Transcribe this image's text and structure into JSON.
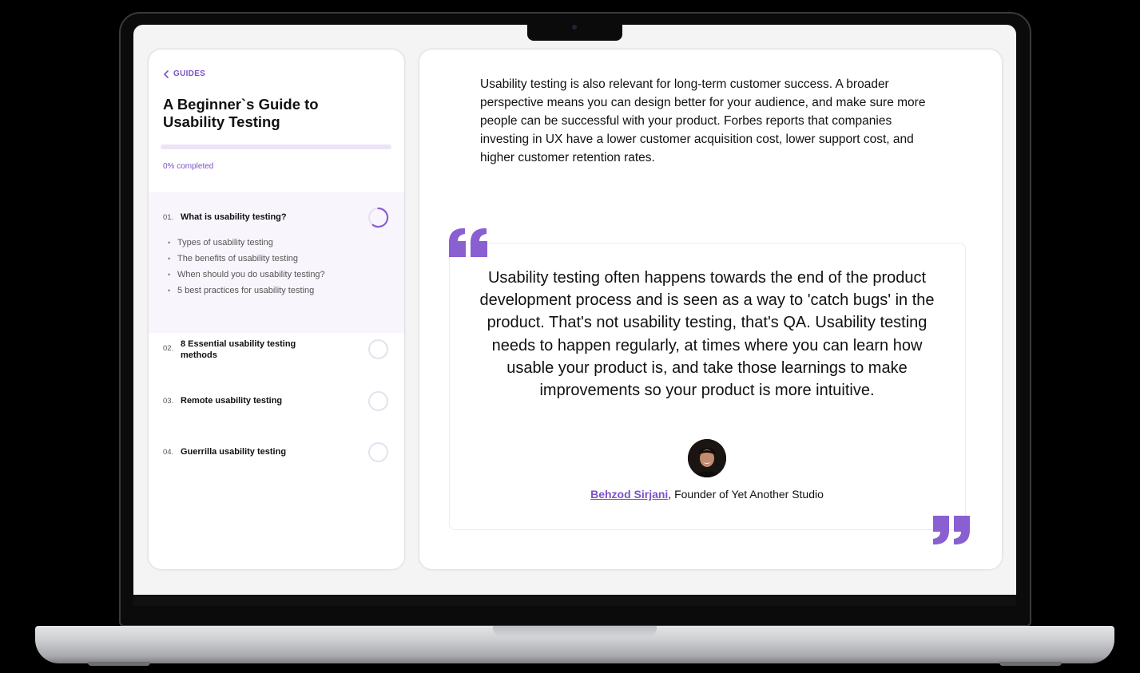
{
  "sidebar": {
    "back_label": "GUIDES",
    "title": "A Beginner`s Guide to Usability Testing",
    "progress_percent": 0,
    "progress_text": "0% completed",
    "chapters": [
      {
        "num": "01.",
        "label": "What is usability testing?",
        "status": "in-progress"
      },
      {
        "num": "02.",
        "label": "8 Essential usability testing methods",
        "status": "not-started"
      },
      {
        "num": "03.",
        "label": "Remote usability testing",
        "status": "not-started"
      },
      {
        "num": "04.",
        "label": "Guerrilla usability testing",
        "status": "not-started"
      }
    ],
    "subitems": [
      "Types of usability testing",
      "The benefits of usability testing",
      "When should you do usability testing?",
      "5 best practices for usability testing"
    ]
  },
  "content": {
    "intro": "Usability testing is also relevant for long-term customer success. A broader perspective means you can design better for your audience, and make sure more people can be successful with your product. Forbes reports that companies investing in UX have a lower customer acquisition cost, lower support cost, and higher customer retention rates.",
    "quote": "Usability testing often happens towards the end of the product development process and is seen as a way to 'catch bugs' in the product. That's not usability testing, that's QA. Usability testing needs to happen regularly, at times where you can learn how usable your product is, and take those learnings to make improvements so your product is more intuitive.",
    "author_name": "Behzod Sirjani",
    "author_role": ", Founder of Yet Another Studio"
  },
  "colors": {
    "accent": "#7b52c8",
    "accent_quote": "#8a5fd2",
    "progress_track": "#ece4f8",
    "active_bg": "#f8f5fc",
    "ring_inactive": "#e6e1ee"
  },
  "icons": {
    "back": "chevron-left-icon",
    "chapter_status": "progress-ring-icon",
    "quote_open": "quote-open-icon",
    "quote_close": "quote-close-icon"
  }
}
